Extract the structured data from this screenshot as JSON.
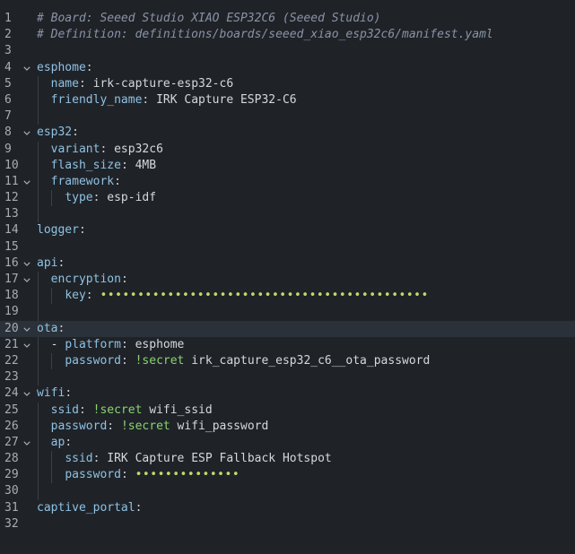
{
  "editor": {
    "language": "yaml",
    "active_line": 20,
    "colors": {
      "background": "#1f2328",
      "active_line": "#2b3138",
      "comment": "#8a93a5",
      "key": "#8fc1e3",
      "tag": "#8bd36f",
      "masked": "#c7d66a",
      "line_number": "#a8adb5"
    },
    "fold_icon": "chevron-down-icon",
    "lines": [
      {
        "n": "1",
        "indent": 0,
        "fold": false,
        "tokens": [
          {
            "t": "comment",
            "v": "# Board: Seeed Studio XIAO ESP32C6 (Seeed Studio)"
          }
        ]
      },
      {
        "n": "2",
        "indent": 0,
        "fold": false,
        "tokens": [
          {
            "t": "comment",
            "v": "# Definition: definitions/boards/seeed_xiao_esp32c6/manifest.yaml"
          }
        ]
      },
      {
        "n": "3",
        "indent": 0,
        "fold": false,
        "tokens": []
      },
      {
        "n": "4",
        "indent": 0,
        "fold": true,
        "tokens": [
          {
            "t": "key",
            "v": "esphome"
          },
          {
            "t": "punc",
            "v": ":"
          }
        ]
      },
      {
        "n": "5",
        "indent": 1,
        "fold": false,
        "tokens": [
          {
            "t": "key",
            "v": "name"
          },
          {
            "t": "punc",
            "v": ": "
          },
          {
            "t": "value",
            "v": "irk-capture-esp32-c6"
          }
        ]
      },
      {
        "n": "6",
        "indent": 1,
        "fold": false,
        "tokens": [
          {
            "t": "key",
            "v": "friendly_name"
          },
          {
            "t": "punc",
            "v": ": "
          },
          {
            "t": "value",
            "v": "IRK Capture ESP32-C6"
          }
        ]
      },
      {
        "n": "7",
        "indent": 1,
        "fold": false,
        "tokens": []
      },
      {
        "n": "8",
        "indent": 0,
        "fold": true,
        "tokens": [
          {
            "t": "key",
            "v": "esp32"
          },
          {
            "t": "punc",
            "v": ":"
          }
        ]
      },
      {
        "n": "9",
        "indent": 1,
        "fold": false,
        "tokens": [
          {
            "t": "key",
            "v": "variant"
          },
          {
            "t": "punc",
            "v": ": "
          },
          {
            "t": "value",
            "v": "esp32c6"
          }
        ]
      },
      {
        "n": "10",
        "indent": 1,
        "fold": false,
        "tokens": [
          {
            "t": "key",
            "v": "flash_size"
          },
          {
            "t": "punc",
            "v": ": "
          },
          {
            "t": "value",
            "v": "4MB"
          }
        ]
      },
      {
        "n": "11",
        "indent": 1,
        "fold": true,
        "tokens": [
          {
            "t": "key",
            "v": "framework"
          },
          {
            "t": "punc",
            "v": ":"
          }
        ]
      },
      {
        "n": "12",
        "indent": 2,
        "fold": false,
        "tokens": [
          {
            "t": "key",
            "v": "type"
          },
          {
            "t": "punc",
            "v": ": "
          },
          {
            "t": "value",
            "v": "esp-idf"
          }
        ]
      },
      {
        "n": "13",
        "indent": 1,
        "fold": false,
        "tokens": []
      },
      {
        "n": "14",
        "indent": 0,
        "fold": false,
        "tokens": [
          {
            "t": "key",
            "v": "logger"
          },
          {
            "t": "punc",
            "v": ":"
          }
        ]
      },
      {
        "n": "15",
        "indent": 0,
        "fold": false,
        "tokens": []
      },
      {
        "n": "16",
        "indent": 0,
        "fold": true,
        "tokens": [
          {
            "t": "key",
            "v": "api"
          },
          {
            "t": "punc",
            "v": ":"
          }
        ]
      },
      {
        "n": "17",
        "indent": 1,
        "fold": true,
        "tokens": [
          {
            "t": "key",
            "v": "encryption"
          },
          {
            "t": "punc",
            "v": ":"
          }
        ]
      },
      {
        "n": "18",
        "indent": 2,
        "fold": false,
        "tokens": [
          {
            "t": "key",
            "v": "key"
          },
          {
            "t": "punc",
            "v": ": "
          },
          {
            "t": "mask",
            "v": "••••••••••••••••••••••••••••••••••••••••••••"
          }
        ]
      },
      {
        "n": "19",
        "indent": 1,
        "fold": false,
        "tokens": []
      },
      {
        "n": "20",
        "indent": 0,
        "fold": true,
        "tokens": [
          {
            "t": "key",
            "v": "ota"
          },
          {
            "t": "punc",
            "v": ":"
          }
        ]
      },
      {
        "n": "21",
        "indent": 1,
        "fold": true,
        "tokens": [
          {
            "t": "dash",
            "v": "- "
          },
          {
            "t": "key",
            "v": "platform"
          },
          {
            "t": "punc",
            "v": ": "
          },
          {
            "t": "value",
            "v": "esphome"
          }
        ]
      },
      {
        "n": "22",
        "indent": 2,
        "fold": false,
        "tokens": [
          {
            "t": "key",
            "v": "password"
          },
          {
            "t": "punc",
            "v": ": "
          },
          {
            "t": "tag",
            "v": "!secret"
          },
          {
            "t": "value",
            "v": " irk_capture_esp32_c6__ota_password"
          }
        ]
      },
      {
        "n": "23",
        "indent": 1,
        "fold": false,
        "tokens": []
      },
      {
        "n": "24",
        "indent": 0,
        "fold": true,
        "tokens": [
          {
            "t": "key",
            "v": "wifi"
          },
          {
            "t": "punc",
            "v": ":"
          }
        ]
      },
      {
        "n": "25",
        "indent": 1,
        "fold": false,
        "tokens": [
          {
            "t": "key",
            "v": "ssid"
          },
          {
            "t": "punc",
            "v": ": "
          },
          {
            "t": "tag",
            "v": "!secret"
          },
          {
            "t": "value",
            "v": " wifi_ssid"
          }
        ]
      },
      {
        "n": "26",
        "indent": 1,
        "fold": false,
        "tokens": [
          {
            "t": "key",
            "v": "password"
          },
          {
            "t": "punc",
            "v": ": "
          },
          {
            "t": "tag",
            "v": "!secret"
          },
          {
            "t": "value",
            "v": " wifi_password"
          }
        ]
      },
      {
        "n": "27",
        "indent": 1,
        "fold": true,
        "tokens": [
          {
            "t": "key",
            "v": "ap"
          },
          {
            "t": "punc",
            "v": ":"
          }
        ]
      },
      {
        "n": "28",
        "indent": 2,
        "fold": false,
        "tokens": [
          {
            "t": "key",
            "v": "ssid"
          },
          {
            "t": "punc",
            "v": ": "
          },
          {
            "t": "value",
            "v": "IRK Capture ESP Fallback Hotspot"
          }
        ]
      },
      {
        "n": "29",
        "indent": 2,
        "fold": false,
        "tokens": [
          {
            "t": "key",
            "v": "password"
          },
          {
            "t": "punc",
            "v": ": "
          },
          {
            "t": "mask",
            "v": "••••••••••••••"
          }
        ]
      },
      {
        "n": "30",
        "indent": 1,
        "fold": false,
        "tokens": []
      },
      {
        "n": "31",
        "indent": 0,
        "fold": false,
        "tokens": [
          {
            "t": "key",
            "v": "captive_portal"
          },
          {
            "t": "punc",
            "v": ":"
          }
        ]
      },
      {
        "n": "32",
        "indent": 0,
        "fold": false,
        "tokens": []
      }
    ]
  }
}
